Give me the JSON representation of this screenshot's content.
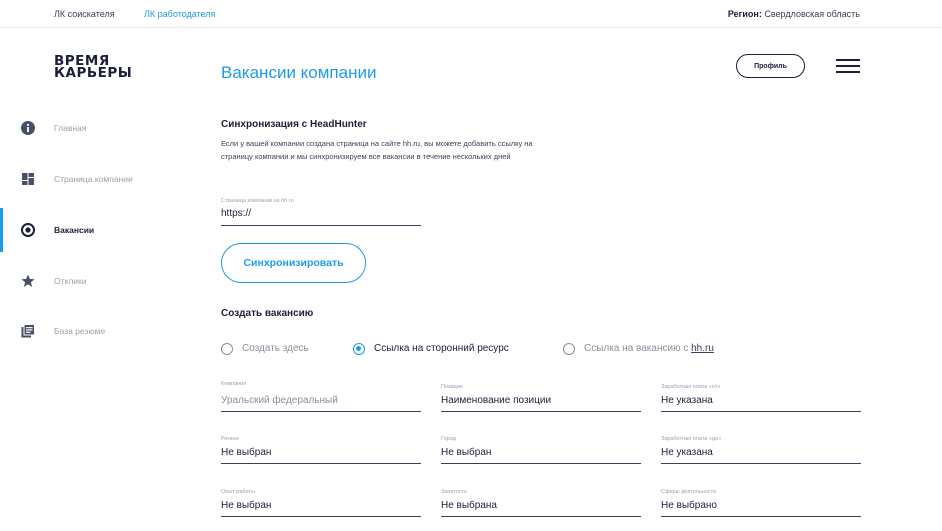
{
  "topbar": {
    "link_seeker": "ЛК соискателя",
    "link_employer": "ЛК работодателя",
    "region_label": "Регион:",
    "region_value": "Свердловская область"
  },
  "header": {
    "logo_line1": "ВРЕМЯ",
    "logo_line2": "КАРЬЕРЫ",
    "title": "Вакансии компании",
    "profile_label": "Профиль"
  },
  "sidebar": {
    "items": [
      {
        "label": "Главная",
        "icon": "info-icon"
      },
      {
        "label": "Страница компании",
        "icon": "dashboard-icon"
      },
      {
        "label": "Вакансии",
        "icon": "target-icon",
        "active": true
      },
      {
        "label": "Отклики",
        "icon": "star-icon"
      },
      {
        "label": "База резюме",
        "icon": "library-icon"
      }
    ]
  },
  "sync": {
    "title": "Синхронизация с HeadHunter",
    "description": "Если у вашей компании создана страница на сайте hh.ru, вы можете добавить ссылку на страницу компании и мы синхронизируем все вакансии в течение нескольких дней",
    "field_label": "Страница компании на hh.ru",
    "field_value": "https://",
    "button_label": "Синхронизировать"
  },
  "create": {
    "title": "Создать вакансию",
    "radios": [
      {
        "label": "Создать здесь",
        "checked": false
      },
      {
        "label": "Ссылка на сторонний ресурс",
        "checked": true
      },
      {
        "label_prefix": "Ссылка на вакансию с ",
        "label_link": "hh.ru",
        "checked": false
      }
    ],
    "fields": {
      "company": {
        "label": "Компания",
        "value": "Уральский федеральный"
      },
      "position": {
        "label": "Позиция",
        "value": "Наименование позиции"
      },
      "salary_from": {
        "label": "Заработная плата «от»",
        "value": "Не указана"
      },
      "region": {
        "label": "Регион",
        "value": "Не выбран"
      },
      "city": {
        "label": "Город",
        "value": "Не выбран"
      },
      "salary_to": {
        "label": "Заработная плата «до»",
        "value": "Не указана"
      },
      "experience": {
        "label": "Опыт работы",
        "value": "Не выбран"
      },
      "employment": {
        "label": "Занятость",
        "value": "Не выбрана"
      },
      "spheres": {
        "label": "Сферы деятельности",
        "value": "Не выбрано"
      }
    }
  },
  "colors": {
    "accent": "#1e9be6",
    "dark": "#1b1f3b",
    "muted": "#9aa0ad"
  }
}
